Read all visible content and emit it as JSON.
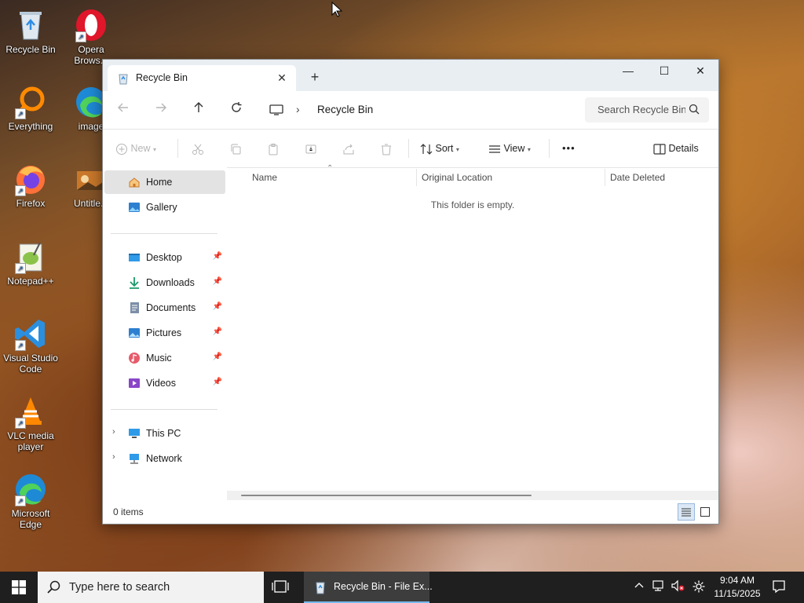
{
  "desktop": {
    "icons": [
      {
        "label": "Recycle Bin",
        "icon": "recycle-bin-icon"
      },
      {
        "label": "Opera Brows...",
        "icon": "opera-icon"
      },
      {
        "label": "Everything",
        "icon": "everything-icon"
      },
      {
        "label": "image",
        "icon": "edge-icon"
      },
      {
        "label": "Firefox",
        "icon": "firefox-icon"
      },
      {
        "label": "Untitle...",
        "icon": "image-file-icon"
      },
      {
        "label": "Notepad++",
        "icon": "notepadpp-icon"
      },
      {
        "label": "Visual Studio Code",
        "icon": "vscode-icon"
      },
      {
        "label": "VLC media player",
        "icon": "vlc-icon"
      },
      {
        "label": "Microsoft Edge",
        "icon": "edge-icon"
      }
    ]
  },
  "window": {
    "tab_title": "Recycle Bin",
    "tab_close": "✕",
    "new_tab": "+",
    "controls": {
      "minimize": "—",
      "maximize": "☐",
      "close": "✕"
    }
  },
  "address": {
    "breadcrumb_separator": "›",
    "breadcrumb": "Recycle Bin",
    "search_placeholder": "Search Recycle Bin"
  },
  "toolbar": {
    "new_label": "New",
    "sort_label": "Sort",
    "view_label": "View",
    "more_label": "•••",
    "details_label": "Details"
  },
  "nav": {
    "home": "Home",
    "gallery": "Gallery",
    "pinned": [
      {
        "label": "Desktop",
        "icon": "desktop-icon"
      },
      {
        "label": "Downloads",
        "icon": "downloads-icon"
      },
      {
        "label": "Documents",
        "icon": "documents-icon"
      },
      {
        "label": "Pictures",
        "icon": "pictures-icon"
      },
      {
        "label": "Music",
        "icon": "music-icon"
      },
      {
        "label": "Videos",
        "icon": "videos-icon"
      }
    ],
    "this_pc": "This PC",
    "network": "Network"
  },
  "columns": {
    "name": "Name",
    "original_location": "Original Location",
    "date_deleted": "Date Deleted"
  },
  "content": {
    "empty_message": "This folder is empty."
  },
  "status": {
    "items": "0 items"
  },
  "taskbar": {
    "search_placeholder": "Type here to search",
    "active_app": "Recycle Bin - File Ex...",
    "time": "9:04 AM",
    "date": "11/15/2025"
  },
  "colors": {
    "accent": "#0067c0",
    "taskbar_bg": "#1f1f1f",
    "selected_nav": "#e3e3e3"
  }
}
